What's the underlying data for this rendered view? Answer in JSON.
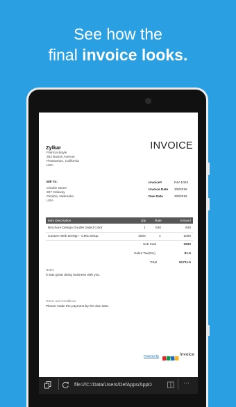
{
  "promo": {
    "line1": "See how the",
    "line2_a": "final ",
    "line2_b": "invoice looks."
  },
  "invoice": {
    "company": "Zylkar",
    "from_lines": [
      "Patricia Boyle",
      "352 Burton Avenue",
      "Pleasanton, California",
      "USA"
    ],
    "title": "INVOICE",
    "bill_to_label": "Bill To:",
    "bill_to_lines": [
      "Charlie Stone",
      "397 Oakway",
      "Omaha, Nebraska",
      "USA"
    ],
    "meta": [
      {
        "label": "Invoice#",
        "value": "INV-1003"
      },
      {
        "label": "Invoice Date",
        "value": "3/9/2016"
      },
      {
        "label": "Due Date",
        "value": "3/9/2016"
      }
    ],
    "columns": {
      "item": "Item Description",
      "qty": "Qty",
      "rate": "Rate",
      "amount": "Amount"
    },
    "items": [
      {
        "desc": "Brochure Design Double Sided Color",
        "qty": "1",
        "rate": "630",
        "amount": "630"
      },
      {
        "desc": "Custom Web Design - CMS Setup",
        "qty": "1000",
        "rate": "1",
        "amount": "1000"
      }
    ],
    "totals": [
      {
        "label": "Sub total",
        "value": "1630"
      },
      {
        "label": "Sales Tax(5%)",
        "value": "81.5"
      },
      {
        "label": "Total",
        "value": "$1711.5"
      }
    ],
    "notes_label": "Notes",
    "notes_text": "It was great doing business with you.",
    "terms_label": "Terms and Conditions",
    "terms_text": "Please make the payment by the due date.",
    "powered_by": "Powered by",
    "brand_logo": "zoho",
    "brand_product": "Invoice"
  },
  "browser": {
    "url": "file:///C:/Data/Users/DefApps/AppD",
    "tabs_icon": "tabs-icon",
    "refresh_icon": "refresh-icon",
    "reading_icon": "reading-view-icon",
    "more_label": "···"
  },
  "colors": {
    "background": "#2aa0e3",
    "table_header": "#575757",
    "zoho_red": "#e42527",
    "zoho_green": "#089949",
    "zoho_blue": "#226db4",
    "zoho_yellow": "#f9b21d"
  }
}
